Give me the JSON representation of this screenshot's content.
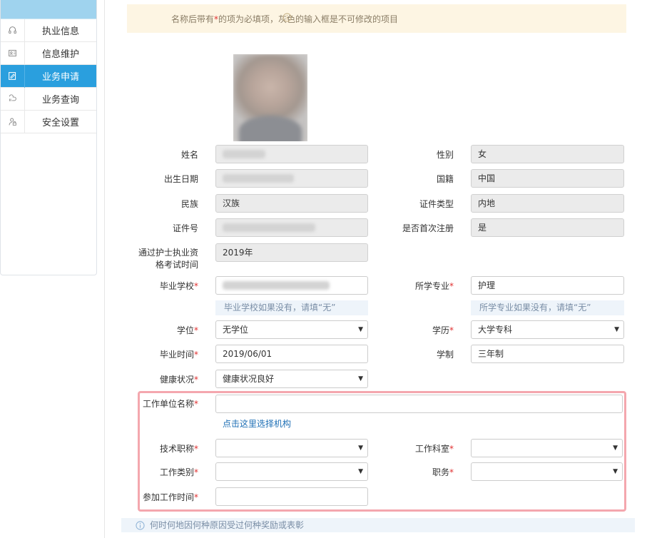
{
  "sidebar": {
    "items": [
      {
        "label": "执业信息",
        "icon": "headset-icon"
      },
      {
        "label": "信息维护",
        "icon": "id-card-icon"
      },
      {
        "label": "业务申请",
        "icon": "form-edit-icon",
        "active": true
      },
      {
        "label": "业务查询",
        "icon": "query-icon"
      },
      {
        "label": "安全设置",
        "icon": "user-lock-icon"
      }
    ]
  },
  "notice": {
    "text_before": "名称后带有",
    "star": "*",
    "text_after": "的项为必填项，灰色的输入框是不可修改的项目"
  },
  "form": {
    "name": {
      "label": "姓名",
      "value": ""
    },
    "gender": {
      "label": "性别",
      "value": "女"
    },
    "birth_date": {
      "label": "出生日期",
      "value": ""
    },
    "nationality": {
      "label": "国籍",
      "value": "中国"
    },
    "ethnicity": {
      "label": "民族",
      "value": "汉族"
    },
    "id_type": {
      "label": "证件类型",
      "value": "内地"
    },
    "id_number": {
      "label": "证件号",
      "value": ""
    },
    "first_registration": {
      "label": "是否首次注册",
      "value": "是"
    },
    "exam_time": {
      "label_line1": "通过护士执业资",
      "label_line2": "格考试时间",
      "value": "2019年"
    },
    "school": {
      "label": "毕业学校",
      "value": "",
      "hint": "毕业学校如果没有，请填“无”"
    },
    "major": {
      "label": "所学专业",
      "value": "护理",
      "hint": "所学专业如果没有，请填“无”"
    },
    "degree": {
      "label": "学位",
      "value": "无学位"
    },
    "education": {
      "label": "学历",
      "value": "大学专科"
    },
    "grad_date": {
      "label": "毕业时间",
      "value": "2019/06/01"
    },
    "schooling": {
      "label": "学制",
      "value": "三年制"
    },
    "health": {
      "label": "健康状况",
      "value": "健康状况良好"
    },
    "work_unit": {
      "label": "工作单位名称",
      "value": "",
      "link": "点击这里选择机构"
    },
    "title": {
      "label": "技术职称",
      "value": ""
    },
    "department": {
      "label": "工作科室",
      "value": ""
    },
    "work_type": {
      "label": "工作类别",
      "value": ""
    },
    "position": {
      "label": "职务",
      "value": ""
    },
    "work_start": {
      "label": "参加工作时间",
      "value": ""
    },
    "required_mark": "*"
  },
  "bottom_notice": "何时何地因何种原因受过何种奖励或表彰"
}
